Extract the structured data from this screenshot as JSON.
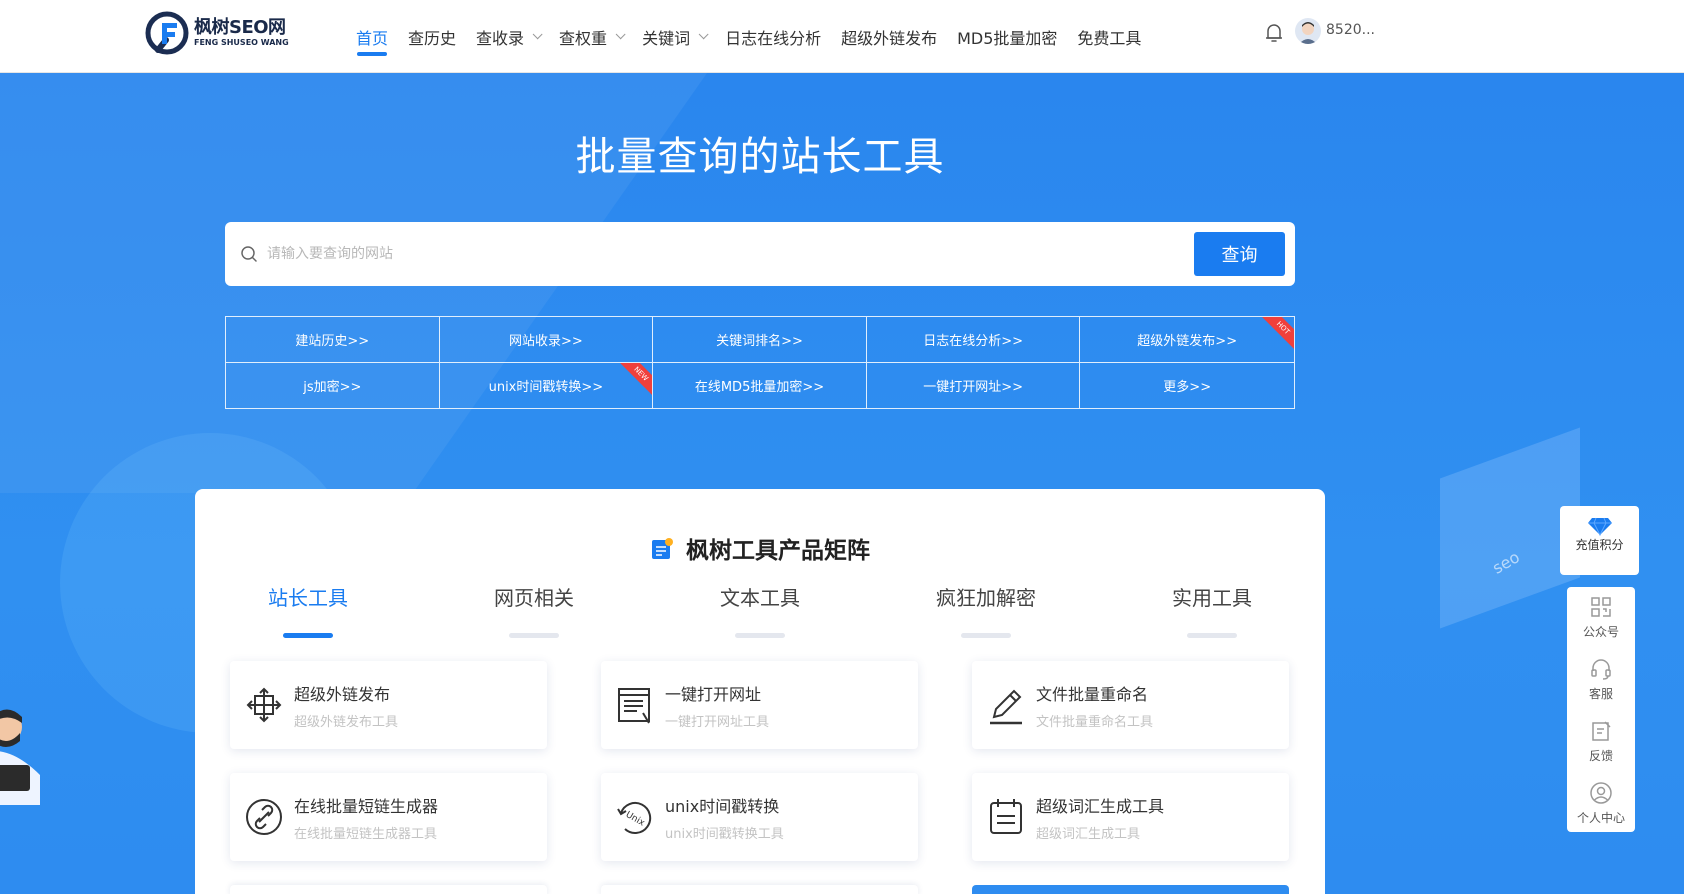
{
  "header": {
    "logo_cn": "枫树SEO网",
    "logo_en": "FENG SHUSEO WANG",
    "nav": [
      {
        "label": "首页",
        "active": true,
        "dropdown": false
      },
      {
        "label": "查历史",
        "active": false,
        "dropdown": false
      },
      {
        "label": "查收录",
        "active": false,
        "dropdown": true
      },
      {
        "label": "查权重",
        "active": false,
        "dropdown": true
      },
      {
        "label": "关键词",
        "active": false,
        "dropdown": true
      },
      {
        "label": "日志在线分析",
        "active": false,
        "dropdown": false
      },
      {
        "label": "超级外链发布",
        "active": false,
        "dropdown": false
      },
      {
        "label": "MD5批量加密",
        "active": false,
        "dropdown": false
      },
      {
        "label": "免费工具",
        "active": false,
        "dropdown": false
      }
    ],
    "username": "8520..."
  },
  "hero": {
    "title": "批量查询的站长工具",
    "search_placeholder": "请输入要查询的网站",
    "search_button": "查询"
  },
  "quick_links": [
    {
      "label": "建站历史>>",
      "badge": ""
    },
    {
      "label": "网站收录>>",
      "badge": ""
    },
    {
      "label": "关键词排名>>",
      "badge": ""
    },
    {
      "label": "日志在线分析>>",
      "badge": ""
    },
    {
      "label": "超级外链发布>>",
      "badge": "HOT"
    },
    {
      "label": "js加密>>",
      "badge": ""
    },
    {
      "label": "unix时间戳转换>>",
      "badge": "NEW"
    },
    {
      "label": "在线MD5批量加密>>",
      "badge": ""
    },
    {
      "label": "一键打开网址>>",
      "badge": ""
    },
    {
      "label": "更多>>",
      "badge": ""
    }
  ],
  "products": {
    "title": "枫树工具产品矩阵",
    "tabs": [
      "站长工具",
      "网页相关",
      "文本工具",
      "疯狂加解密",
      "实用工具"
    ],
    "active_tab": 0,
    "cards": [
      {
        "title": "超级外链发布",
        "subtitle": "超级外链发布工具",
        "icon": "link-publish-icon"
      },
      {
        "title": "一键打开网址",
        "subtitle": "一键打开网址工具",
        "icon": "open-url-icon"
      },
      {
        "title": "文件批量重命名",
        "subtitle": "文件批量重命名工具",
        "icon": "pen-icon"
      },
      {
        "title": "在线批量短链生成器",
        "subtitle": "在线批量短链生成器工具",
        "icon": "chain-link-icon"
      },
      {
        "title": "unix时间戳转换",
        "subtitle": "unix时间戳转换工具",
        "icon": "unix-clock-icon"
      },
      {
        "title": "超级词汇生成工具",
        "subtitle": "超级词汇生成工具",
        "icon": "calendar-list-icon"
      }
    ]
  },
  "float_bar": {
    "recharge": "充值积分",
    "items": [
      "公众号",
      "客服",
      "反馈",
      "个人中心"
    ]
  },
  "colors": {
    "primary": "#1a7cf0",
    "hero_bg": "#2b8aef",
    "badge_red": "#f0403c"
  }
}
